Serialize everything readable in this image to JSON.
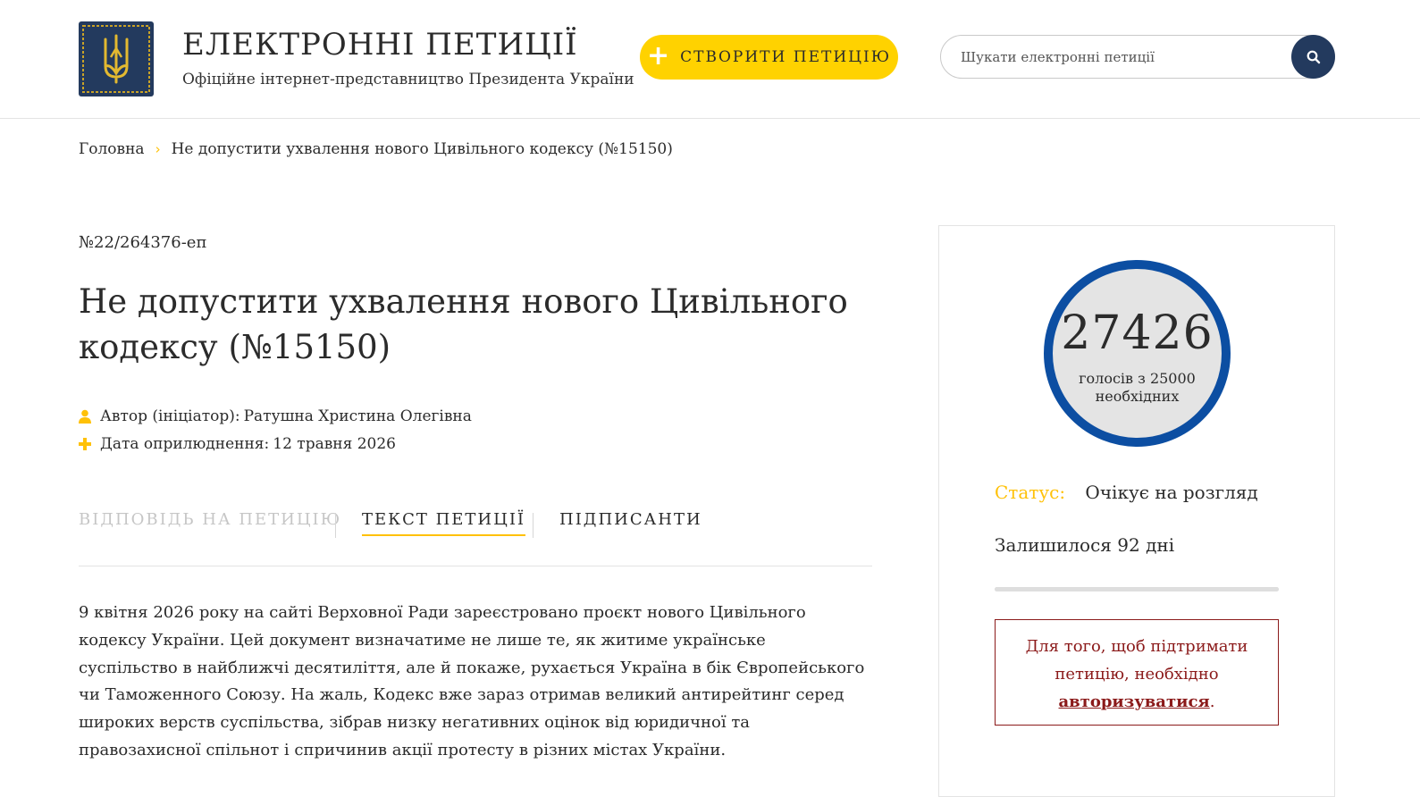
{
  "header": {
    "title": "ЕЛЕКТРОННІ ПЕТИЦІЇ",
    "subtitle": "Офіційне інтернет-представництво Президента України",
    "create_button": "СТВОРИТИ ПЕТИЦІЮ",
    "search_placeholder": "Шукати електронні петиції"
  },
  "breadcrumb": {
    "home": "Головна",
    "current": "Не допустити ухвалення нового Цивільного кодексу (№15150)"
  },
  "petition": {
    "number": "№22/264376-еп",
    "title": "Не допустити ухвалення нового Цивільного кодексу (№15150)",
    "author_label": "Автор (ініціатор):",
    "author": "Ратушна Христина Олегівна",
    "date_label": "Дата оприлюднення:",
    "date": "12 травня 2026",
    "text": "9 квітня 2026 року на сайті Верховної Ради зареєстровано проєкт нового Цивільного кодексу України. Цей документ визначатиме не лише те, як житиме українське суспільство в найближчі десятиліття, але й покаже, рухається Україна в бік Європейського чи Таможенного Союзу. На жаль, Кодекс вже зараз отримав великий антирейтинг серед широких верств суспільства, зібрав низку негативних оцінок від юридичної та правозахисної спільнот і спричинив акції протесту в різних містах України."
  },
  "tabs": [
    {
      "label": "Відповідь на петицію",
      "state": "disabled"
    },
    {
      "label": "Текст петиції",
      "state": "active"
    },
    {
      "label": "Підписанти",
      "state": "normal"
    }
  ],
  "sidebar": {
    "votes": "27426",
    "votes_label": "голосів з 25000 необхідних",
    "status_label": "Статус:",
    "status_value": "Очікує на розгляд",
    "days_left": "Залишилося 92 дні",
    "auth_text": "Для того, щоб підтримати петицію, необхідно",
    "auth_link": "авторизуватися",
    "auth_suffix": "."
  },
  "colors": {
    "accent_yellow": "#ffd200",
    "navy": "#233a5e",
    "circle_blue": "#0c4ea2",
    "warning_red": "#8b1a1a"
  },
  "icons": {
    "logo": "trident-emblem",
    "search": "search-icon",
    "author": "user-icon",
    "date": "plus-icon",
    "breadcrumb_separator": "chevron-right-icon"
  }
}
